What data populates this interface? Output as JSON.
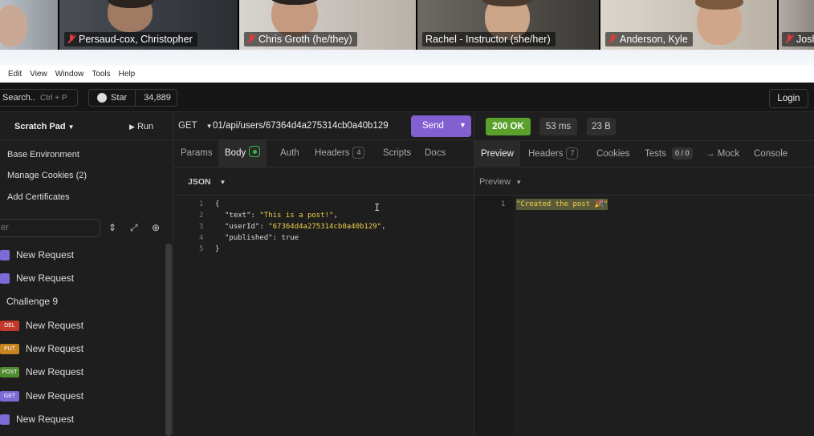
{
  "video": {
    "participants": [
      {
        "name": "Persaud-cox, Christopher",
        "muted": true
      },
      {
        "name": "Chris Groth (he/they)",
        "muted": true
      },
      {
        "name": "Rachel - Instructor (she/her)",
        "muted": false,
        "active": true
      },
      {
        "name": "Anderson, Kyle",
        "muted": true
      },
      {
        "name": "Josh",
        "muted": true
      }
    ]
  },
  "menu": [
    "Edit",
    "View",
    "Window",
    "Tools",
    "Help"
  ],
  "toolbar": {
    "search_label": "Search..",
    "search_shortcut": "Ctrl + P",
    "star_label": "Star",
    "star_count": "34,889",
    "login_label": "Login"
  },
  "sidebar": {
    "scratch_pad": "Scratch Pad",
    "run_label": "Run",
    "links": [
      "Base Environment",
      "Manage Cookies (2)",
      "Add Certificates"
    ],
    "filter_placeholder": "er",
    "requests": [
      {
        "method": "",
        "label": "New Request",
        "color": "#7c6ad6"
      },
      {
        "method": "",
        "label": "New Request",
        "color": "#7c6ad6"
      },
      {
        "method": "",
        "label": "Challenge 9",
        "color": ""
      },
      {
        "method": "DEL",
        "label": "New Request",
        "color": "#c0392b"
      },
      {
        "method": "PUT",
        "label": "New Request",
        "color": "#c8841f"
      },
      {
        "method": "POST",
        "label": "New Request",
        "color": "#4f8a2e"
      },
      {
        "method": "GET",
        "label": "New Request",
        "color": "#7c6ad6"
      },
      {
        "method": "",
        "label": "New Request",
        "color": "#7c6ad6"
      }
    ]
  },
  "request": {
    "method": "GET",
    "url": "01/api/users/67364d4a275314cb0a40b129",
    "send_label": "Send",
    "tabs": {
      "params": "Params",
      "body": "Body",
      "auth": "Auth",
      "headers": "Headers",
      "headers_count": "4",
      "scripts": "Scripts",
      "docs": "Docs"
    },
    "body_type": "JSON",
    "lines": {
      "l1": "{",
      "l2_key": "\"text\"",
      "l2_val": "\"This is a post!\"",
      "l3_key": "\"userId\"",
      "l3_val": "\"67364d4a275314cb0a40b129\"",
      "l4_key": "\"published\"",
      "l4_val": "true",
      "l5": "}"
    },
    "line_numbers": [
      "1",
      "2",
      "3",
      "4",
      "5"
    ]
  },
  "response": {
    "status": "200 OK",
    "time": "53 ms",
    "size": "23 B",
    "tabs": {
      "preview": "Preview",
      "headers": "Headers",
      "headers_count": "7",
      "cookies": "Cookies",
      "tests": "Tests",
      "tests_count": "0 / 0",
      "mock": "→ Mock",
      "console": "Console"
    },
    "preview_mode": "Preview",
    "line_number": "1",
    "body": "\"Created the post 🎉\""
  },
  "colors": {
    "accent": "#8260d2",
    "status_ok": "#5aa02c"
  }
}
